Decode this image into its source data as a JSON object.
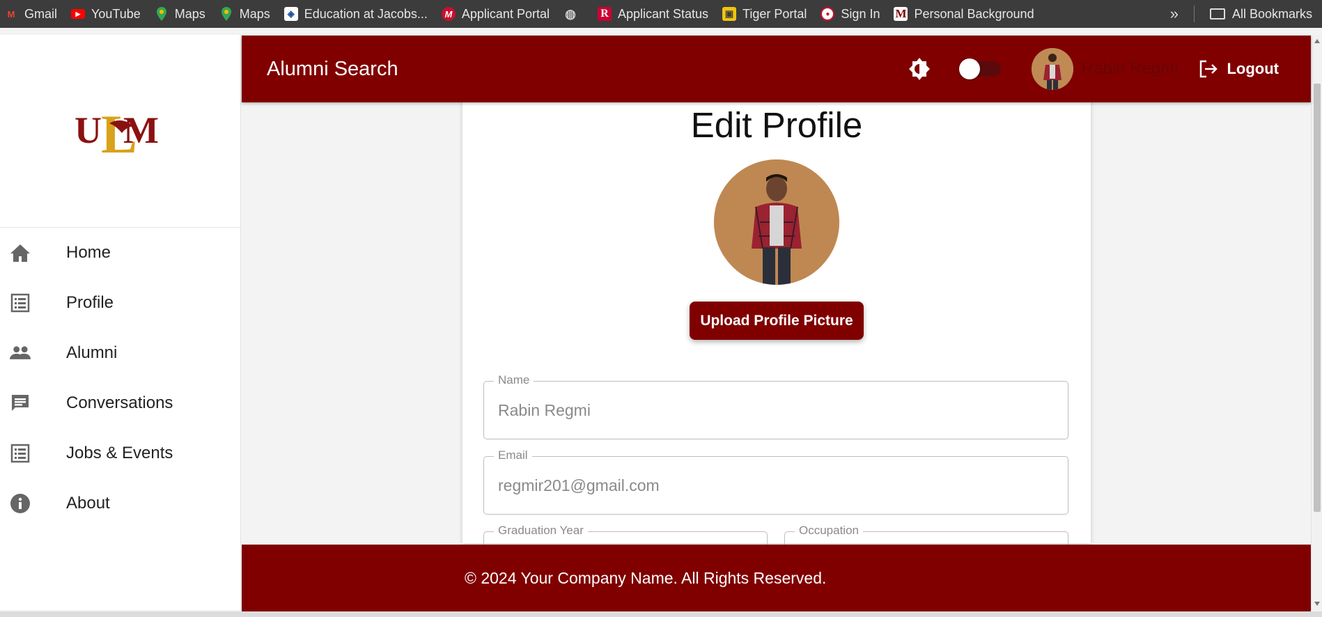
{
  "bookmarks": {
    "items": [
      {
        "label": "Gmail",
        "icon": "gmail-icon"
      },
      {
        "label": "YouTube",
        "icon": "youtube-icon"
      },
      {
        "label": "Maps",
        "icon": "maps-icon"
      },
      {
        "label": "Maps",
        "icon": "maps-icon"
      },
      {
        "label": "Education at Jacobs...",
        "icon": "shield-icon"
      },
      {
        "label": "Applicant Portal",
        "icon": "applicant-portal-icon"
      },
      {
        "label": "",
        "icon": "globe-icon"
      },
      {
        "label": "Applicant Status",
        "icon": "r-logo-icon"
      },
      {
        "label": "Tiger Portal",
        "icon": "tiger-icon"
      },
      {
        "label": "Sign In",
        "icon": "seal-icon"
      },
      {
        "label": "Personal Background",
        "icon": "m-logo-icon"
      }
    ],
    "all_bookmarks_label": "All Bookmarks"
  },
  "sidebar": {
    "logo_text": "ULM",
    "items": [
      {
        "label": "Home",
        "icon": "home-icon"
      },
      {
        "label": "Profile",
        "icon": "list-icon"
      },
      {
        "label": "Alumni",
        "icon": "people-icon"
      },
      {
        "label": "Conversations",
        "icon": "chat-icon"
      },
      {
        "label": "Jobs & Events",
        "icon": "list-icon"
      },
      {
        "label": "About",
        "icon": "info-icon"
      }
    ]
  },
  "header": {
    "title": "Alumni Search",
    "user_name": "Rabin Regmi",
    "logout_label": "Logout"
  },
  "form": {
    "title": "Edit Profile",
    "upload_button": "Upload Profile Picture",
    "fields": {
      "name": {
        "label": "Name",
        "value": "Rabin Regmi"
      },
      "email": {
        "label": "Email",
        "value": "regmir201@gmail.com"
      },
      "graduation_year": {
        "label": "Graduation Year",
        "value": ""
      },
      "occupation": {
        "label": "Occupation",
        "value": ""
      }
    }
  },
  "footer": {
    "text": "© 2024 Your Company Name. All Rights Reserved."
  },
  "colors": {
    "brand": "#800000",
    "bookmarks_bar": "#3c3c3c",
    "logo_gold": "#d9a21b"
  }
}
